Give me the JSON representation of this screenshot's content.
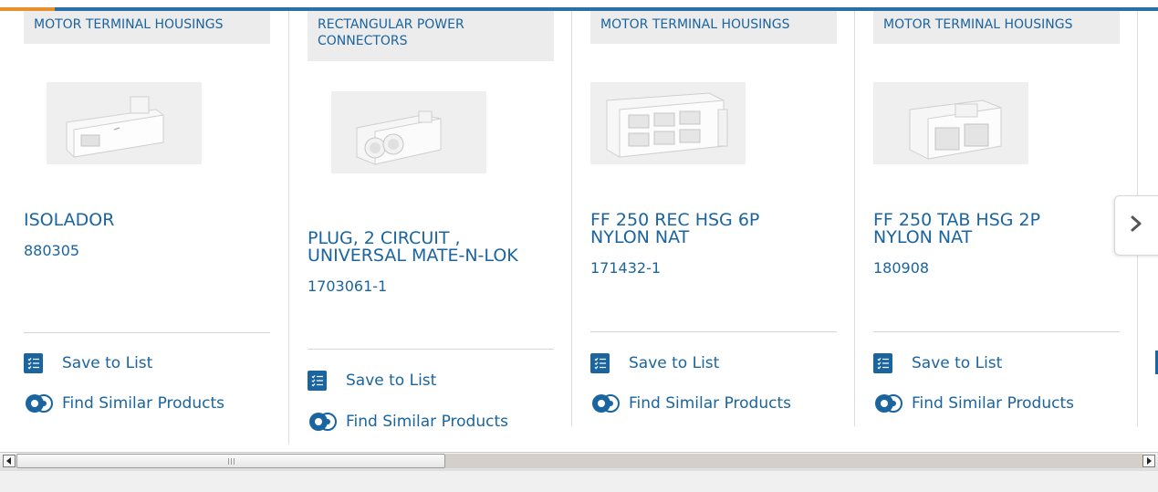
{
  "carousel": {
    "products": [
      {
        "category": "MOTOR TERMINAL HOUSINGS",
        "name": "ISOLADOR",
        "part_number": "880305",
        "save_label": "Save to List",
        "similar_label": "Find Similar Products"
      },
      {
        "category": "RECTANGULAR POWER CONNECTORS",
        "name": "PLUG, 2 CIRCUIT , UNIVERSAL MATE-N-LOK",
        "part_number": "1703061-1",
        "save_label": "Save to List",
        "similar_label": "Find Similar Products"
      },
      {
        "category": "MOTOR TERMINAL HOUSINGS",
        "name": "FF 250 REC HSG 6P NYLON NAT",
        "part_number": "171432-1",
        "save_label": "Save to List",
        "similar_label": "Find Similar Products"
      },
      {
        "category": "MOTOR TERMINAL HOUSINGS",
        "name": "FF 250 TAB HSG 2P NYLON NAT",
        "part_number": "180908",
        "save_label": "Save to List",
        "similar_label": "Find Similar Products"
      }
    ],
    "next_icon": "chevron-right-icon"
  },
  "colors": {
    "link": "#1a64a0",
    "top_bar": "#2a70a6",
    "top_accent": "#e98f2d",
    "tag_bg": "#ececec"
  }
}
